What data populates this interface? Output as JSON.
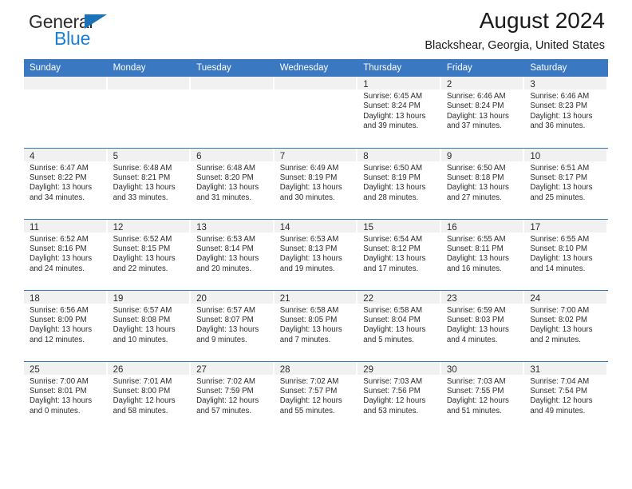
{
  "brand": {
    "name_top": "General",
    "name_bottom": "Blue",
    "accent_color": "#1b7fd4",
    "triangle_color": "#1b72b8"
  },
  "header": {
    "title": "August 2024",
    "subtitle": "Blackshear, Georgia, United States",
    "header_bg_color": "#3b78c2",
    "daynum_band_color": "#f1f1f1"
  },
  "weekday_headers": [
    "Sunday",
    "Monday",
    "Tuesday",
    "Wednesday",
    "Thursday",
    "Friday",
    "Saturday"
  ],
  "labels": {
    "sunrise_prefix": "Sunrise:",
    "sunset_prefix": "Sunset:",
    "daylight_prefix": "Daylight:"
  },
  "weeks": [
    [
      {
        "day": ""
      },
      {
        "day": ""
      },
      {
        "day": ""
      },
      {
        "day": ""
      },
      {
        "day": "1",
        "sunrise": "Sunrise: 6:45 AM",
        "sunset": "Sunset: 8:24 PM",
        "daylight": "Daylight: 13 hours and 39 minutes."
      },
      {
        "day": "2",
        "sunrise": "Sunrise: 6:46 AM",
        "sunset": "Sunset: 8:24 PM",
        "daylight": "Daylight: 13 hours and 37 minutes."
      },
      {
        "day": "3",
        "sunrise": "Sunrise: 6:46 AM",
        "sunset": "Sunset: 8:23 PM",
        "daylight": "Daylight: 13 hours and 36 minutes."
      }
    ],
    [
      {
        "day": "4",
        "sunrise": "Sunrise: 6:47 AM",
        "sunset": "Sunset: 8:22 PM",
        "daylight": "Daylight: 13 hours and 34 minutes."
      },
      {
        "day": "5",
        "sunrise": "Sunrise: 6:48 AM",
        "sunset": "Sunset: 8:21 PM",
        "daylight": "Daylight: 13 hours and 33 minutes."
      },
      {
        "day": "6",
        "sunrise": "Sunrise: 6:48 AM",
        "sunset": "Sunset: 8:20 PM",
        "daylight": "Daylight: 13 hours and 31 minutes."
      },
      {
        "day": "7",
        "sunrise": "Sunrise: 6:49 AM",
        "sunset": "Sunset: 8:19 PM",
        "daylight": "Daylight: 13 hours and 30 minutes."
      },
      {
        "day": "8",
        "sunrise": "Sunrise: 6:50 AM",
        "sunset": "Sunset: 8:19 PM",
        "daylight": "Daylight: 13 hours and 28 minutes."
      },
      {
        "day": "9",
        "sunrise": "Sunrise: 6:50 AM",
        "sunset": "Sunset: 8:18 PM",
        "daylight": "Daylight: 13 hours and 27 minutes."
      },
      {
        "day": "10",
        "sunrise": "Sunrise: 6:51 AM",
        "sunset": "Sunset: 8:17 PM",
        "daylight": "Daylight: 13 hours and 25 minutes."
      }
    ],
    [
      {
        "day": "11",
        "sunrise": "Sunrise: 6:52 AM",
        "sunset": "Sunset: 8:16 PM",
        "daylight": "Daylight: 13 hours and 24 minutes."
      },
      {
        "day": "12",
        "sunrise": "Sunrise: 6:52 AM",
        "sunset": "Sunset: 8:15 PM",
        "daylight": "Daylight: 13 hours and 22 minutes."
      },
      {
        "day": "13",
        "sunrise": "Sunrise: 6:53 AM",
        "sunset": "Sunset: 8:14 PM",
        "daylight": "Daylight: 13 hours and 20 minutes."
      },
      {
        "day": "14",
        "sunrise": "Sunrise: 6:53 AM",
        "sunset": "Sunset: 8:13 PM",
        "daylight": "Daylight: 13 hours and 19 minutes."
      },
      {
        "day": "15",
        "sunrise": "Sunrise: 6:54 AM",
        "sunset": "Sunset: 8:12 PM",
        "daylight": "Daylight: 13 hours and 17 minutes."
      },
      {
        "day": "16",
        "sunrise": "Sunrise: 6:55 AM",
        "sunset": "Sunset: 8:11 PM",
        "daylight": "Daylight: 13 hours and 16 minutes."
      },
      {
        "day": "17",
        "sunrise": "Sunrise: 6:55 AM",
        "sunset": "Sunset: 8:10 PM",
        "daylight": "Daylight: 13 hours and 14 minutes."
      }
    ],
    [
      {
        "day": "18",
        "sunrise": "Sunrise: 6:56 AM",
        "sunset": "Sunset: 8:09 PM",
        "daylight": "Daylight: 13 hours and 12 minutes."
      },
      {
        "day": "19",
        "sunrise": "Sunrise: 6:57 AM",
        "sunset": "Sunset: 8:08 PM",
        "daylight": "Daylight: 13 hours and 10 minutes."
      },
      {
        "day": "20",
        "sunrise": "Sunrise: 6:57 AM",
        "sunset": "Sunset: 8:07 PM",
        "daylight": "Daylight: 13 hours and 9 minutes."
      },
      {
        "day": "21",
        "sunrise": "Sunrise: 6:58 AM",
        "sunset": "Sunset: 8:05 PM",
        "daylight": "Daylight: 13 hours and 7 minutes."
      },
      {
        "day": "22",
        "sunrise": "Sunrise: 6:58 AM",
        "sunset": "Sunset: 8:04 PM",
        "daylight": "Daylight: 13 hours and 5 minutes."
      },
      {
        "day": "23",
        "sunrise": "Sunrise: 6:59 AM",
        "sunset": "Sunset: 8:03 PM",
        "daylight": "Daylight: 13 hours and 4 minutes."
      },
      {
        "day": "24",
        "sunrise": "Sunrise: 7:00 AM",
        "sunset": "Sunset: 8:02 PM",
        "daylight": "Daylight: 13 hours and 2 minutes."
      }
    ],
    [
      {
        "day": "25",
        "sunrise": "Sunrise: 7:00 AM",
        "sunset": "Sunset: 8:01 PM",
        "daylight": "Daylight: 13 hours and 0 minutes."
      },
      {
        "day": "26",
        "sunrise": "Sunrise: 7:01 AM",
        "sunset": "Sunset: 8:00 PM",
        "daylight": "Daylight: 12 hours and 58 minutes."
      },
      {
        "day": "27",
        "sunrise": "Sunrise: 7:02 AM",
        "sunset": "Sunset: 7:59 PM",
        "daylight": "Daylight: 12 hours and 57 minutes."
      },
      {
        "day": "28",
        "sunrise": "Sunrise: 7:02 AM",
        "sunset": "Sunset: 7:57 PM",
        "daylight": "Daylight: 12 hours and 55 minutes."
      },
      {
        "day": "29",
        "sunrise": "Sunrise: 7:03 AM",
        "sunset": "Sunset: 7:56 PM",
        "daylight": "Daylight: 12 hours and 53 minutes."
      },
      {
        "day": "30",
        "sunrise": "Sunrise: 7:03 AM",
        "sunset": "Sunset: 7:55 PM",
        "daylight": "Daylight: 12 hours and 51 minutes."
      },
      {
        "day": "31",
        "sunrise": "Sunrise: 7:04 AM",
        "sunset": "Sunset: 7:54 PM",
        "daylight": "Daylight: 12 hours and 49 minutes."
      }
    ]
  ]
}
